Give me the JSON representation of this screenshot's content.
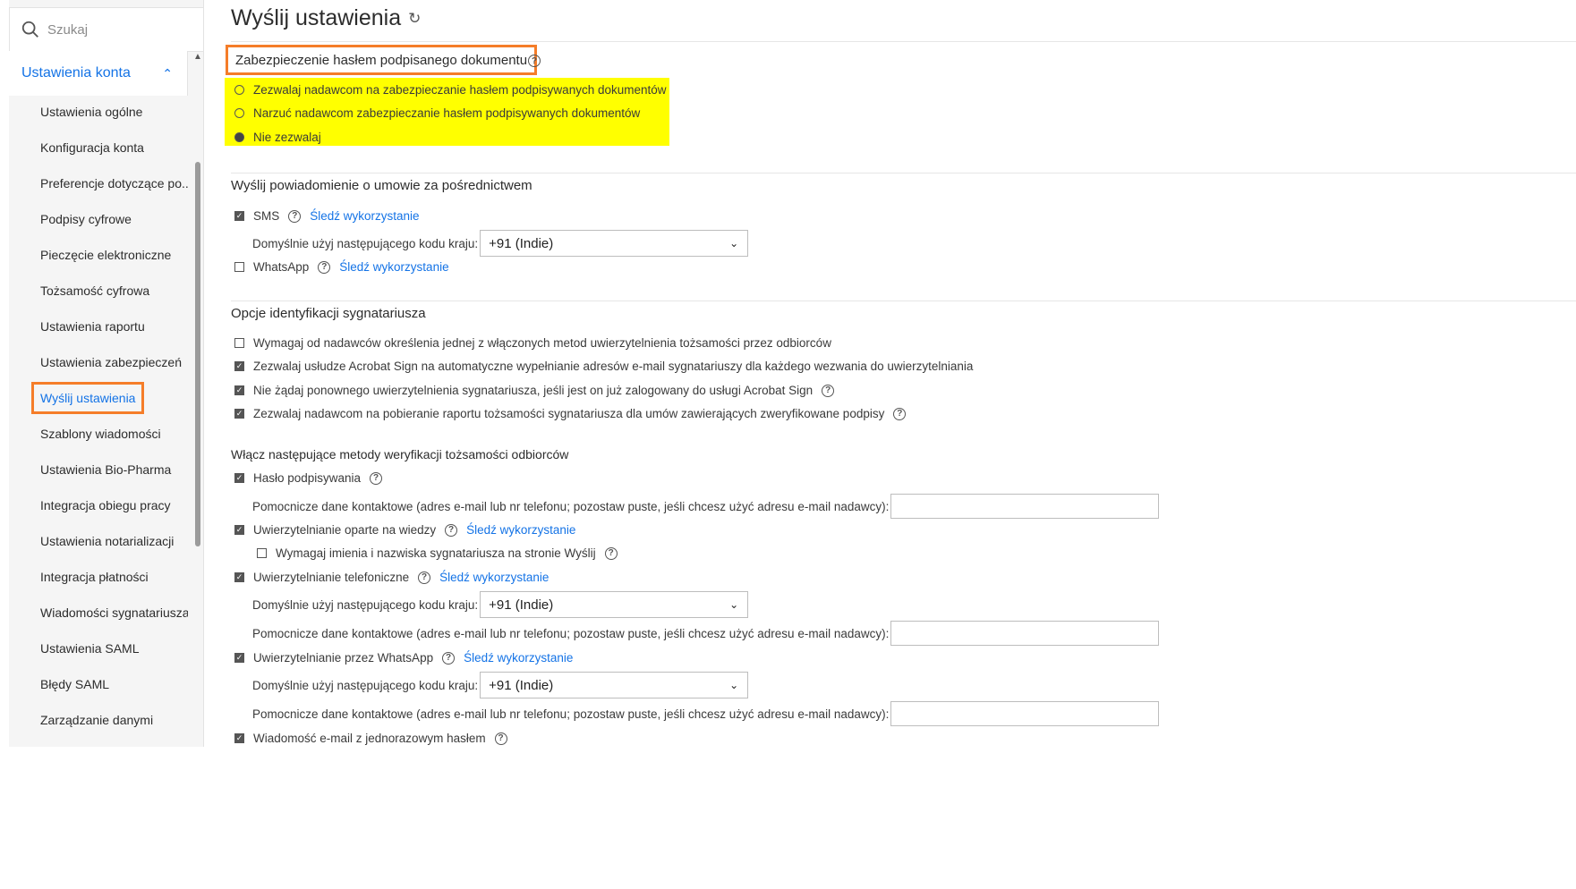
{
  "search": {
    "placeholder": "Szukaj"
  },
  "sidebar": {
    "section_label": "Ustawienia konta",
    "items": [
      "Ustawienia ogólne",
      "Konfiguracja konta",
      "Preferencje dotyczące po...",
      "Podpisy cyfrowe",
      "Pieczęcie elektroniczne",
      "Tożsamość cyfrowa",
      "Ustawienia raportu",
      "Ustawienia zabezpieczeń",
      "Wyślij ustawienia",
      "Szablony wiadomości",
      "Ustawienia Bio-Pharma",
      "Integracja obiegu pracy",
      "Ustawienia notarializacji",
      "Integracja płatności",
      "Wiadomości sygnatariusza",
      "Ustawienia SAML",
      "Błędy SAML",
      "Zarządzanie danymi"
    ],
    "active_item": "Wyślij ustawienia"
  },
  "page": {
    "title": "Wyślij ustawienia"
  },
  "password_protection": {
    "title": "Zabezpieczenie hasłem podpisanego dokumentu",
    "options": [
      "Zezwalaj nadawcom na zabezpieczanie hasłem podpisywanych dokumentów",
      "Narzuć nadawcom zabezpieczanie hasłem podpisywanych dokumentów",
      "Nie zezwalaj"
    ],
    "selected": "Nie zezwalaj"
  },
  "notifications": {
    "title": "Wyślij powiadomienie o umowie za pośrednictwem",
    "sms_label": "SMS",
    "sms_checked": true,
    "track_link": "Śledź wykorzystanie",
    "country_label": "Domyślnie użyj następującego kodu kraju:",
    "country_value": "+91 (Indie)",
    "whatsapp_label": "WhatsApp",
    "whatsapp_checked": false
  },
  "identification": {
    "title": "Opcje identyfikacji sygnatariusza",
    "options": [
      {
        "label": "Wymagaj od nadawców określenia jednej z włączonych metod uwierzytelnienia tożsamości przez odbiorców",
        "checked": false
      },
      {
        "label": "Zezwalaj usłudze Acrobat Sign na automatyczne wypełnianie adresów e-mail sygnatariuszy dla każdego wezwania do uwierzytelniania",
        "checked": true
      },
      {
        "label": "Nie żądaj ponownego uwierzytelnienia sygnatariusza, jeśli jest on już zalogowany do usługi Acrobat Sign",
        "checked": true
      },
      {
        "label": "Zezwalaj nadawcom na pobieranie raportu tożsamości sygnatariusza dla umów zawierających zweryfikowane podpisy",
        "checked": true
      }
    ]
  },
  "verification": {
    "title": "Włącz następujące metody weryfikacji tożsamości odbiorców",
    "password_label": "Hasło podpisywania",
    "aux_contact_label": "Pomocnicze dane kontaktowe (adres e-mail lub nr telefonu; pozostaw puste, jeśli chcesz użyć adresu e-mail nadawcy):",
    "kba_label": "Uwierzytelnianie oparte na wiedzy",
    "kba_name_label": "Wymagaj imienia i nazwiska sygnatariusza na stronie Wyślij",
    "phone_label": "Uwierzytelnianie telefoniczne",
    "whatsapp_auth_label": "Uwierzytelnianie przez WhatsApp",
    "otp_label": "Wiadomość e-mail z jednorazowym hasłem",
    "country_label": "Domyślnie użyj następującego kodu kraju:",
    "country_value": "+91 (Indie)",
    "track_link": "Śledź wykorzystanie"
  },
  "colors": {
    "accent": "#1473e6",
    "highlight_border": "#f57d29",
    "highlight_fill": "#ffff00"
  }
}
